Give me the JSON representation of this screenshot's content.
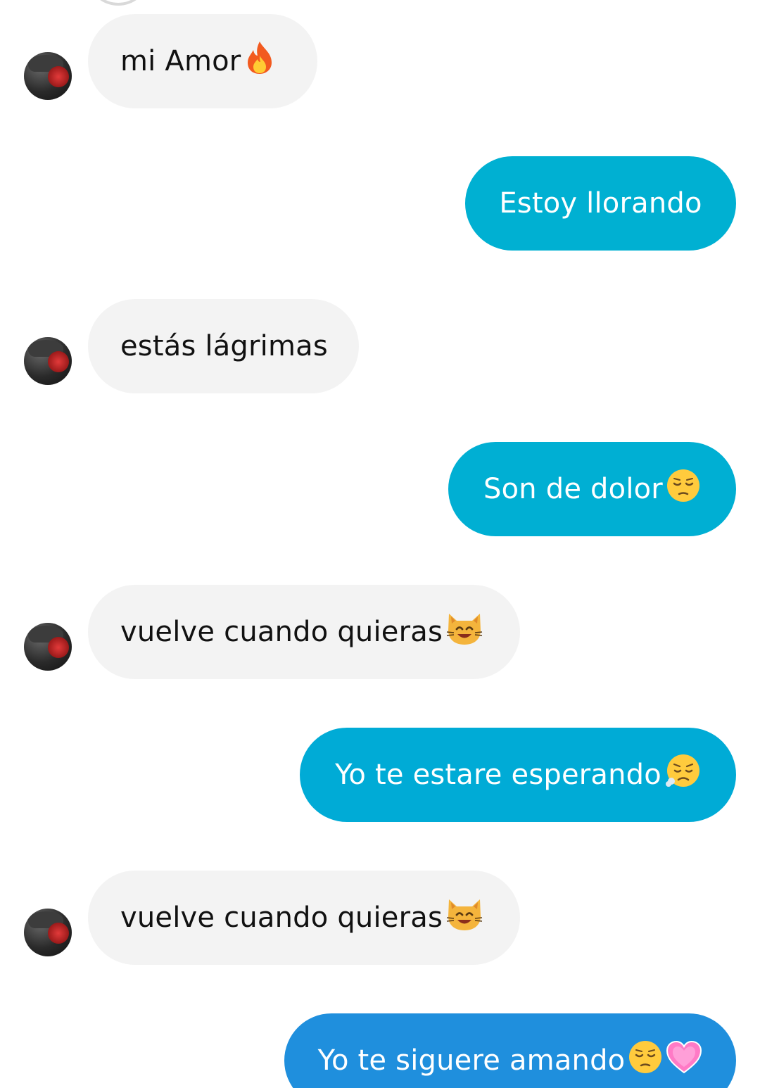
{
  "colors": {
    "incoming_bubble": "#f3f3f3",
    "outgoing_bubble_top": "#00afd1",
    "outgoing_bubble_bottom": "#1f8fdd",
    "incoming_text": "#111111",
    "outgoing_text": "#ffffff"
  },
  "messages": [
    {
      "direction": "incoming",
      "text": "mi Amor ",
      "emoji": [
        "fire-emoji"
      ]
    },
    {
      "direction": "outgoing",
      "text": "Estoy llorando",
      "emoji": []
    },
    {
      "direction": "incoming",
      "text": "estás lágrimas",
      "emoji": []
    },
    {
      "direction": "outgoing",
      "text": "Son de dolor",
      "emoji": [
        "pensive-face-emoji"
      ]
    },
    {
      "direction": "incoming",
      "text": "vuelve cuando quieras ",
      "emoji": [
        "smiling-cat-emoji"
      ]
    },
    {
      "direction": "outgoing",
      "text": "Yo te estare esperando",
      "emoji": [
        "disappointed-face-emoji"
      ]
    },
    {
      "direction": "incoming",
      "text": "vuelve cuando quieras ",
      "emoji": [
        "smiling-cat-emoji"
      ]
    },
    {
      "direction": "outgoing",
      "text": "Yo te siguere amando",
      "emoji": [
        "pensive-face-emoji",
        "pink-heart-emoji"
      ]
    }
  ]
}
